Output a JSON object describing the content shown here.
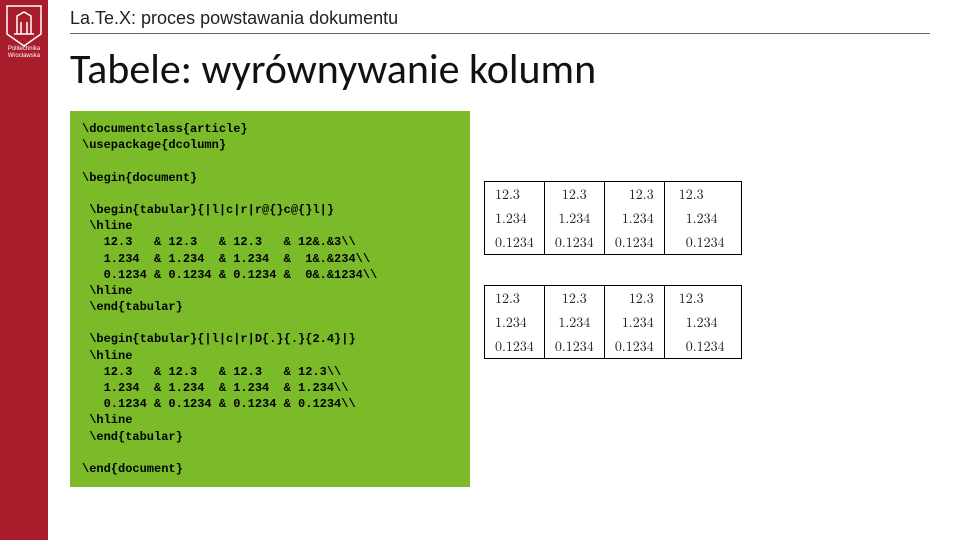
{
  "institution": "Politechnika Wrocławska",
  "breadcrumb": "La.Te.X: proces powstawania dokumentu",
  "title": "Tabele: wyrównywanie kolumn",
  "code": "\\documentclass{article}\n\\usepackage{dcolumn}\n\n\\begin{document}\n\n \\begin{tabular}{|l|c|r|r@{}c@{}l|}\n \\hline\n   12.3   & 12.3   & 12.3   & 12&.&3\\\\\n   1.234  & 1.234  & 1.234  &  1&.&234\\\\\n   0.1234 & 0.1234 & 0.1234 &  0&.&1234\\\\\n \\hline\n \\end{tabular}\n\n \\begin{tabular}{|l|c|r|D{.}{.}{2.4}|}\n \\hline\n   12.3   & 12.3   & 12.3   & 12.3\\\\\n   1.234  & 1.234  & 1.234  & 1.234\\\\\n   0.1234 & 0.1234 & 0.1234 & 0.1234\\\\\n \\hline\n \\end{tabular}\n\n\\end{document}",
  "chart_data": [
    {
      "type": "table",
      "title": "tabular {|l|c|r|r@{}c@{}l|}",
      "columns": [
        "l",
        "c",
        "r",
        "r@{}c@{}l (decimal-aligned)"
      ],
      "rows": [
        [
          "12.3",
          "12.3",
          "12.3",
          "12.3"
        ],
        [
          "1.234",
          "1.234",
          "1.234",
          "1.234"
        ],
        [
          "0.1234",
          "0.1234",
          "0.1234",
          "0.1234"
        ]
      ]
    },
    {
      "type": "table",
      "title": "tabular {|l|c|r|D{.}{.}{2.4}|}",
      "columns": [
        "l",
        "c",
        "r",
        "D{.}{.}{2.4} (decimal-aligned)"
      ],
      "rows": [
        [
          "12.3",
          "12.3",
          "12.3",
          "12.3"
        ],
        [
          "1.234",
          "1.234",
          "1.234",
          "1.234"
        ],
        [
          "0.1234",
          "0.1234",
          "0.1234",
          "0.1234"
        ]
      ]
    }
  ]
}
